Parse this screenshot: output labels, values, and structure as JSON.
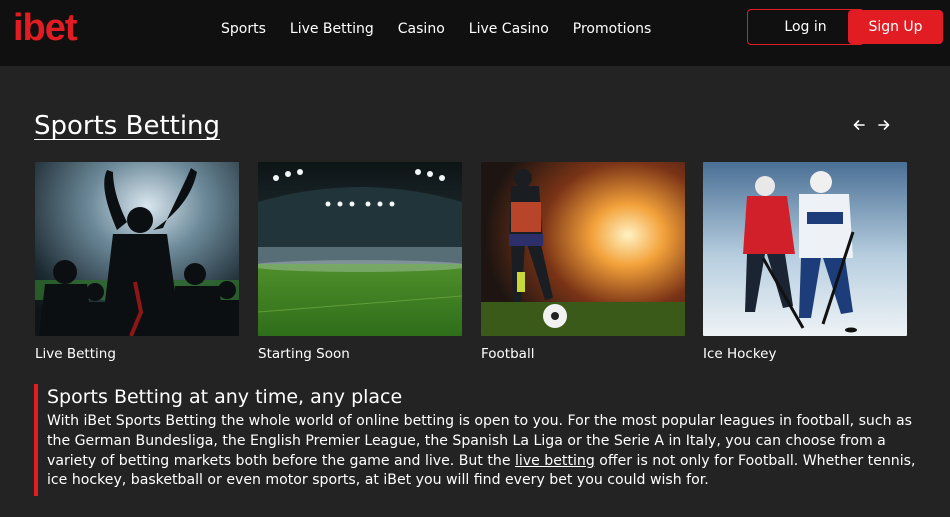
{
  "header": {
    "logo_text": "ibet",
    "nav": [
      "Sports",
      "Live Betting",
      "Casino",
      "Live Casino",
      "Promotions"
    ],
    "login_label": "Log in",
    "signup_label": "Sign Up"
  },
  "section": {
    "title": "Sports Betting",
    "prev_icon": "arrow-left-icon",
    "next_icon": "arrow-right-icon"
  },
  "cards": [
    {
      "label": "Live Betting",
      "image": "stadium-fans-celebrating"
    },
    {
      "label": "Starting Soon",
      "image": "floodlit-stadium-pitch"
    },
    {
      "label": "Football",
      "image": "footballer-with-ball"
    },
    {
      "label": "Ice Hockey",
      "image": "ice-hockey-players"
    }
  ],
  "content": {
    "heading": "Sports Betting at any time, any place",
    "text_before_link": "With iBet Sports Betting the whole world of online betting is open to you. For the most popular leagues in football, such as the German Bundesliga, the English Premier League, the Spanish La Liga or the Serie A in Italy, you can choose from a variety of betting markets both before the game and live. But the ",
    "link_text": "live betting",
    "text_after_link": " offer is not only for Football. Whether tennis, ice hockey, basketball or even motor sports, at iBet you will find every bet you could wish for."
  },
  "colors": {
    "brand_red": "#e21c23",
    "header_bg": "#101010",
    "page_bg": "#232323"
  }
}
